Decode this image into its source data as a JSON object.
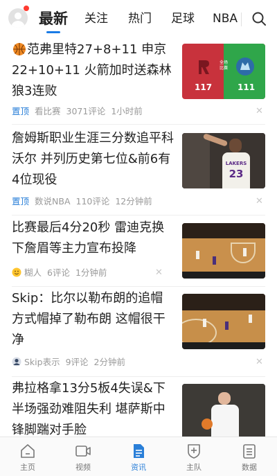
{
  "header": {
    "tabs": [
      {
        "label": "最新",
        "active": true
      },
      {
        "label": "关注",
        "active": false
      },
      {
        "label": "热门",
        "active": false
      },
      {
        "label": "足球",
        "active": false
      },
      {
        "label": "NBA",
        "active": false
      }
    ],
    "accent_color": "#1a7be6"
  },
  "thumb1": {
    "left_score": "117",
    "right_score": "111",
    "badge_line1": "全场",
    "badge_line2": "比赛"
  },
  "thumb2": {
    "jersey_team": "LAKERS",
    "jersey_number": "23"
  },
  "feed": [
    {
      "title": "范弗里特27+8+11 申京22+10+11 火箭加时送森林狼3连败",
      "pinned": "置顶",
      "source": "看比赛",
      "comments": "3071评论",
      "time": "1小时前",
      "leading_icon": "basketball-icon"
    },
    {
      "title": "詹姆斯职业生涯三分数追平科沃尔 并列历史第七位&前6有4位现役",
      "pinned": "置顶",
      "source": "数说NBA",
      "comments": "110评论",
      "time": "12分钟前"
    },
    {
      "title": "比赛最后4分20秒 雷迪克换下詹眉等主力宣布投降",
      "source": "糊人",
      "comments": "6评论",
      "time": "1分钟前",
      "source_icon": "smiley-icon"
    },
    {
      "title": "Skip：比尔以勒布朗的追帽方式帽掉了勒布朗 这帽很干净",
      "source": "Skip表示",
      "comments": "9评论",
      "time": "2分钟前",
      "source_icon": "user-avatar-icon"
    },
    {
      "title": "弗拉格拿13分5板4失误&下半场强劲难阻失利 堪萨斯中锋脚踹对手脸"
    }
  ],
  "bottom_nav": [
    {
      "label": "主页",
      "icon": "home-icon",
      "active": false
    },
    {
      "label": "视频",
      "icon": "video-icon",
      "active": false
    },
    {
      "label": "资讯",
      "icon": "news-icon",
      "active": true
    },
    {
      "label": "主队",
      "icon": "team-shield-icon",
      "active": false
    },
    {
      "label": "数据",
      "icon": "data-list-icon",
      "active": false
    }
  ]
}
